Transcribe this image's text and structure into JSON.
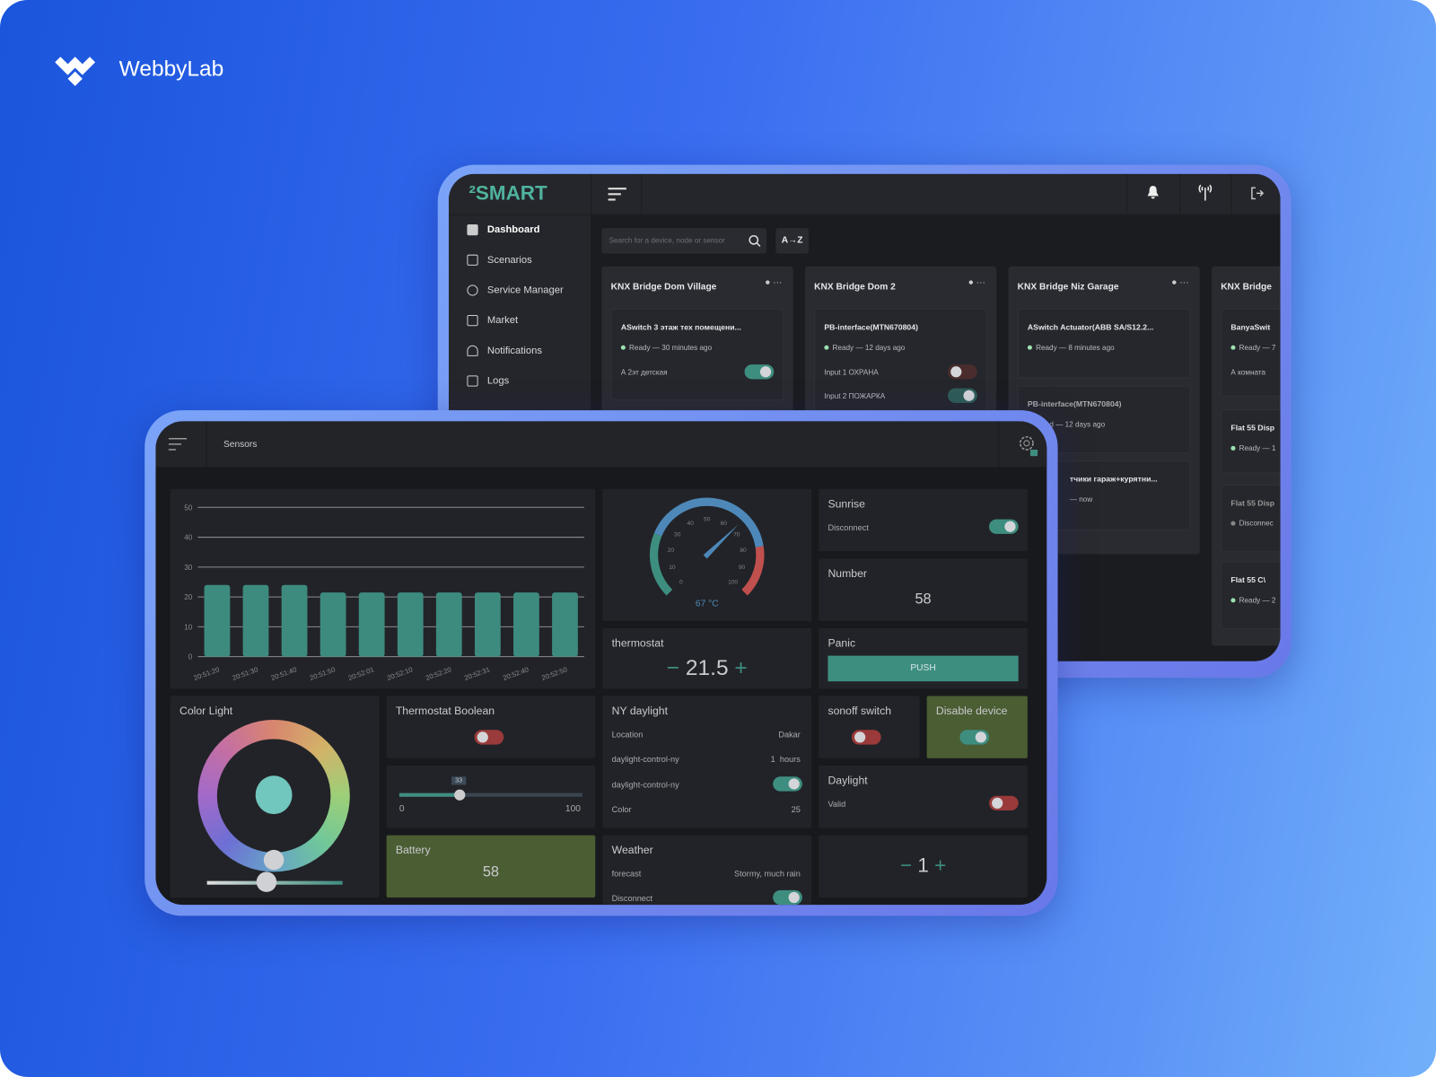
{
  "brand": {
    "name": "WebbyLab"
  },
  "back_app": {
    "logo": "²SMART",
    "sidebar": [
      {
        "label": "Dashboard",
        "icon": "dashboard-icon"
      },
      {
        "label": "Scenarios",
        "icon": "list-icon"
      },
      {
        "label": "Service Manager",
        "icon": "gauge-icon"
      },
      {
        "label": "Market",
        "icon": "cart-icon"
      },
      {
        "label": "Notifications",
        "icon": "bell-icon"
      },
      {
        "label": "Logs",
        "icon": "book-icon"
      }
    ],
    "search_placeholder": "Search for a device, node or sensor",
    "sort_label": "A→Z",
    "cards": [
      {
        "title": "KNX Bridge Dom Village",
        "items": [
          {
            "name": "ASwitch 3 этаж тех помещени...",
            "status": "Ready — 30 minutes ago",
            "rows": [
              {
                "label": "А 2эт детская",
                "toggle": true
              }
            ]
          }
        ]
      },
      {
        "title": "KNX Bridge Dom 2",
        "items": [
          {
            "name": "PB-interface(MTN670804)",
            "status": "Ready — 12 days ago",
            "rows": [
              {
                "label": "Input 1 ОХРАНА",
                "toggle": false
              },
              {
                "label": "Input 2 ПОЖАРКА",
                "toggle": true
              }
            ]
          }
        ]
      },
      {
        "title": "KNX Bridge Niz Garage",
        "items": [
          {
            "name": "ASwitch Actuator(ABB SA/S12.2...",
            "status": "Ready — 8 minutes ago"
          },
          {
            "name": "PB-interface(MTN670804)",
            "status": "nnected — 12 days ago"
          },
          {
            "name": "тчики гараж+курятни...",
            "status": "— now"
          }
        ]
      },
      {
        "title": "KNX Bridge",
        "items": [
          {
            "name": "BanyaSwit",
            "status": "Ready — 7",
            "row": "А комната"
          },
          {
            "name": "Flat 55 Disp",
            "status": "Ready — 1"
          },
          {
            "name": "Flat 55 Disp",
            "status": "Disconnec"
          },
          {
            "name": "Flat 55 C\\",
            "status": "Ready — 2"
          }
        ]
      }
    ]
  },
  "sensors": {
    "title": "Sensors",
    "chart_data": {
      "type": "bar",
      "categories": [
        "20:51:20",
        "20:51:30",
        "20:51:40",
        "20:51:50",
        "20:52:01",
        "20:52:10",
        "20:52:20",
        "20:52:31",
        "20:52:40",
        "20:52:50"
      ],
      "values": [
        24,
        24,
        24,
        21.5,
        21.5,
        21.5,
        21.5,
        21.5,
        21.5,
        21.5
      ],
      "ylim": [
        0,
        50
      ],
      "yticks": [
        0,
        10,
        20,
        30,
        40,
        50
      ],
      "grid": true,
      "color": "#3d8b7e"
    },
    "gauge": {
      "value": 67,
      "unit": "67 °C",
      "ticks": [
        "0",
        "10",
        "20",
        "30",
        "40",
        "50",
        "60",
        "70",
        "80",
        "90",
        "100"
      ]
    },
    "sunrise": {
      "title": "Sunrise",
      "label": "Disconnect",
      "on": true
    },
    "number": {
      "title": "Number",
      "value": "58"
    },
    "thermostat": {
      "title": "thermostat",
      "minus": "−",
      "value": "21.5",
      "plus": "+"
    },
    "panic": {
      "title": "Panic",
      "button": "PUSH"
    },
    "color_light": {
      "title": "Color Light"
    },
    "thermostat_boolean": {
      "title": "Thermostat Boolean",
      "on": false
    },
    "slider": {
      "value": "33",
      "min": "0",
      "max": "100",
      "fraction": 0.33
    },
    "battery": {
      "title": "Battery",
      "value": "58"
    },
    "ny_daylight": {
      "title": "NY daylight",
      "rows": [
        {
          "label": "Location",
          "value": "Dakar"
        },
        {
          "label": "daylight-control-ny",
          "value": "1  hours"
        },
        {
          "label": "daylight-control-ny",
          "toggle": true
        },
        {
          "label": "Color",
          "value": "25"
        }
      ]
    },
    "weather": {
      "title": "Weather",
      "rows": [
        {
          "label": "forecast",
          "value": "Stormy, much rain"
        },
        {
          "label": "Disconnect",
          "toggle": true
        }
      ]
    },
    "sonoff": {
      "title": "sonoff switch",
      "on": false
    },
    "disable_device": {
      "title": "Disable device",
      "on": true
    },
    "daylight": {
      "title": "Daylight",
      "label": "Valid",
      "on": false
    },
    "counter": {
      "minus": "−",
      "value": "1",
      "plus": "+"
    }
  }
}
